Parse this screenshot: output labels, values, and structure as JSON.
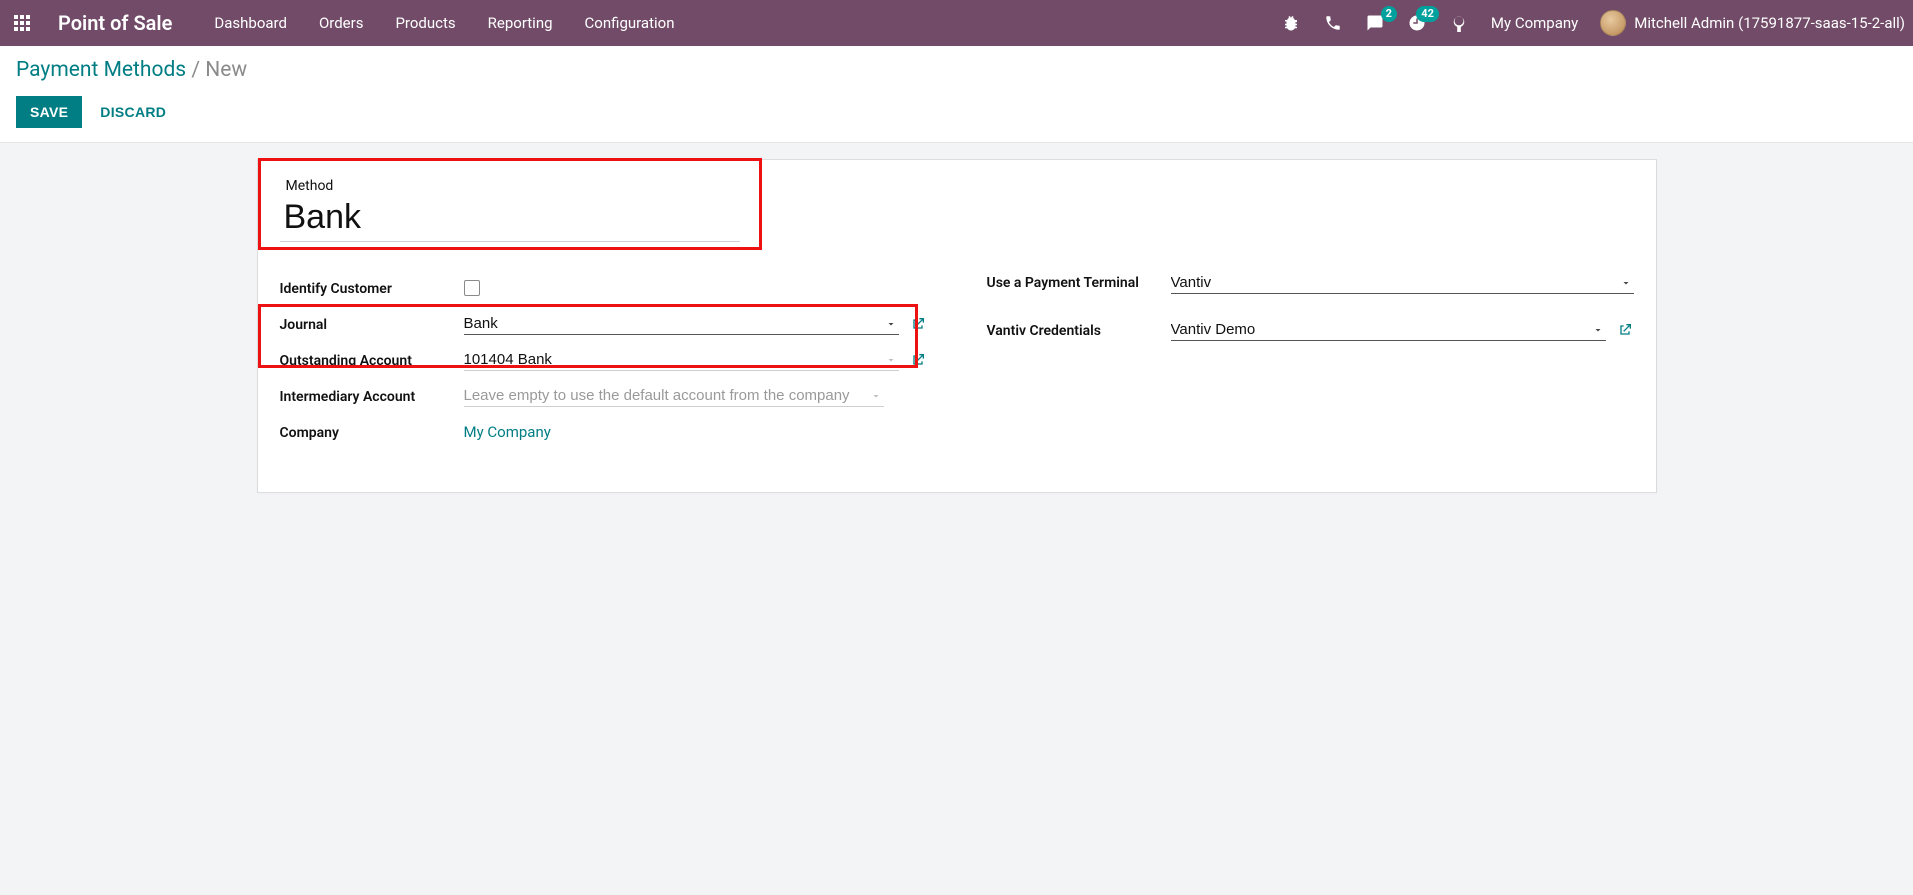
{
  "navbar": {
    "brand": "Point of Sale",
    "links": [
      "Dashboard",
      "Orders",
      "Products",
      "Reporting",
      "Configuration"
    ],
    "messages_badge": "2",
    "activities_badge": "42",
    "company": "My Company",
    "user": "Mitchell Admin (17591877-saas-15-2-all)"
  },
  "breadcrumb": {
    "parent": "Payment Methods",
    "sep": " / ",
    "current": "New"
  },
  "buttons": {
    "save": "SAVE",
    "discard": "DISCARD"
  },
  "form": {
    "method_label": "Method",
    "method_value": "Bank",
    "left": {
      "identify_customer": {
        "label": "Identify Customer",
        "checked": false
      },
      "journal": {
        "label": "Journal",
        "value": "Bank"
      },
      "outstanding_account": {
        "label": "Outstanding Account",
        "value": "101404 Bank"
      },
      "intermediary_account": {
        "label": "Intermediary Account",
        "placeholder": "Leave empty to use the default account from the company"
      },
      "company": {
        "label": "Company",
        "value": "My Company"
      }
    },
    "right": {
      "use_terminal": {
        "label": "Use a Payment Terminal",
        "value": "Vantiv"
      },
      "vantiv_credentials": {
        "label": "Vantiv Credentials",
        "value": "Vantiv Demo"
      }
    }
  }
}
